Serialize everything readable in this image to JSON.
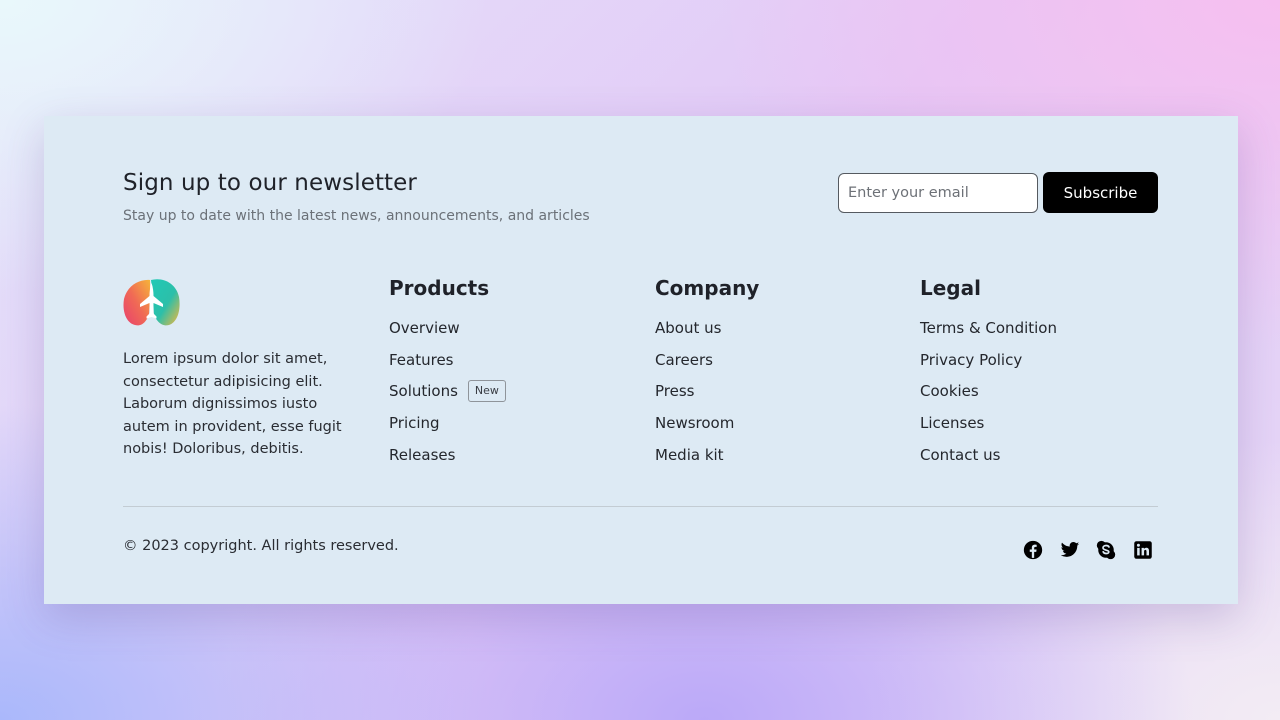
{
  "newsletter": {
    "title": "Sign up to our newsletter",
    "subtitle": "Stay up to date with the latest news, announcements, and articles",
    "email_placeholder": "Enter your email",
    "email_value": "",
    "subscribe_label": "Subscribe"
  },
  "brand": {
    "description": "Lorem ipsum dolor sit amet, consectetur adipisicing elit. Laborum dignissimos iusto autem in provident, esse fugit nobis! Doloribus, debitis."
  },
  "columns": [
    {
      "title": "Products",
      "links": [
        {
          "label": "Overview"
        },
        {
          "label": "Features"
        },
        {
          "label": "Solutions",
          "badge": "New"
        },
        {
          "label": "Pricing"
        },
        {
          "label": "Releases"
        }
      ]
    },
    {
      "title": "Company",
      "links": [
        {
          "label": "About us"
        },
        {
          "label": "Careers"
        },
        {
          "label": "Press"
        },
        {
          "label": "Newsroom"
        },
        {
          "label": "Media kit"
        }
      ]
    },
    {
      "title": "Legal",
      "links": [
        {
          "label": "Terms & Condition"
        },
        {
          "label": "Privacy Policy"
        },
        {
          "label": "Cookies"
        },
        {
          "label": "Licenses"
        },
        {
          "label": "Contact us"
        }
      ]
    }
  ],
  "footer": {
    "copyright": "© 2023 copyright. All rights reserved.",
    "social_icons": [
      "facebook-icon",
      "twitter-icon",
      "skype-icon",
      "linkedin-icon"
    ]
  },
  "colors": {
    "card_background": "#ddeaf4",
    "button_background": "#000000",
    "button_text": "#ffffff",
    "logo_yellow": "#f8b83a",
    "logo_teal": "#22c6b5",
    "logo_pink": "#ef476f"
  }
}
